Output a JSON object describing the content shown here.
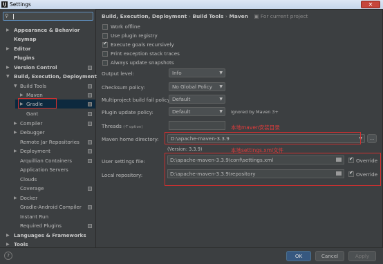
{
  "window": {
    "title": "Settings",
    "app_icon": "intellij-icon"
  },
  "search": {
    "value": ""
  },
  "tree": {
    "appearance": "Appearance & Behavior",
    "keymap": "Keymap",
    "editor": "Editor",
    "plugins": "Plugins",
    "version_control": "Version Control",
    "bed": "Build, Execution, Deployment",
    "build_tools": "Build Tools",
    "maven": "Maven",
    "gradle": "Gradle",
    "gant": "Gant",
    "compiler": "Compiler",
    "debugger": "Debugger",
    "remote_jar": "Remote Jar Repositories",
    "deployment": "Deployment",
    "arquillian": "Arquillian Containers",
    "app_servers": "Application Servers",
    "clouds": "Clouds",
    "coverage": "Coverage",
    "docker": "Docker",
    "gradle_android": "Gradle-Android Compiler",
    "instant_run": "Instant Run",
    "required_plugins": "Required Plugins",
    "languages": "Languages & Frameworks",
    "tools": "Tools"
  },
  "breadcrumb": {
    "part1": "Build, Execution, Deployment",
    "sep": "›",
    "part2": "Build Tools",
    "part3": "Maven",
    "for_project": "For current project"
  },
  "options": {
    "work_offline": "Work offline",
    "plugin_registry": "Use plugin registry",
    "execute_goals": "Execute goals recursively",
    "print_traces": "Print exception stack traces",
    "update_snapshots": "Always update snapshots"
  },
  "settings": {
    "output_level_label": "Output level:",
    "output_level_value": "Info",
    "checksum_label": "Checksum policy:",
    "checksum_value": "No Global Policy",
    "fail_policy_label": "Multiproject build fail policy:",
    "fail_policy_value": "Default",
    "plugin_update_label": "Plugin update policy:",
    "plugin_update_value": "Default",
    "plugin_update_note": "ignored by Maven 3+",
    "threads_label": "Threads",
    "threads_hint": "(-T option)",
    "threads_value": "",
    "home_label": "Maven home directory:",
    "home_value": "D:\\apache-maven-3.3.9",
    "home_more": "...",
    "version": "(Version: 3.3.9)",
    "user_settings_label": "User settings file:",
    "user_settings_value": "D:\\apache-maven-3.3.9\\conf\\settings.xml",
    "override1": "Override",
    "local_repo_label": "Local repository:",
    "local_repo_value": "D:\\apache-maven-3.3.9\\repository",
    "override2": "Override"
  },
  "annotations": {
    "home": "本地maven安装目录",
    "settings": "本地settings.xml文件"
  },
  "footer": {
    "help": "?",
    "ok": "OK",
    "cancel": "Cancel",
    "apply": "Apply"
  },
  "colors": {
    "annotation": "#e43c3c",
    "selection": "#0d293e",
    "ok_button": "#365880"
  }
}
